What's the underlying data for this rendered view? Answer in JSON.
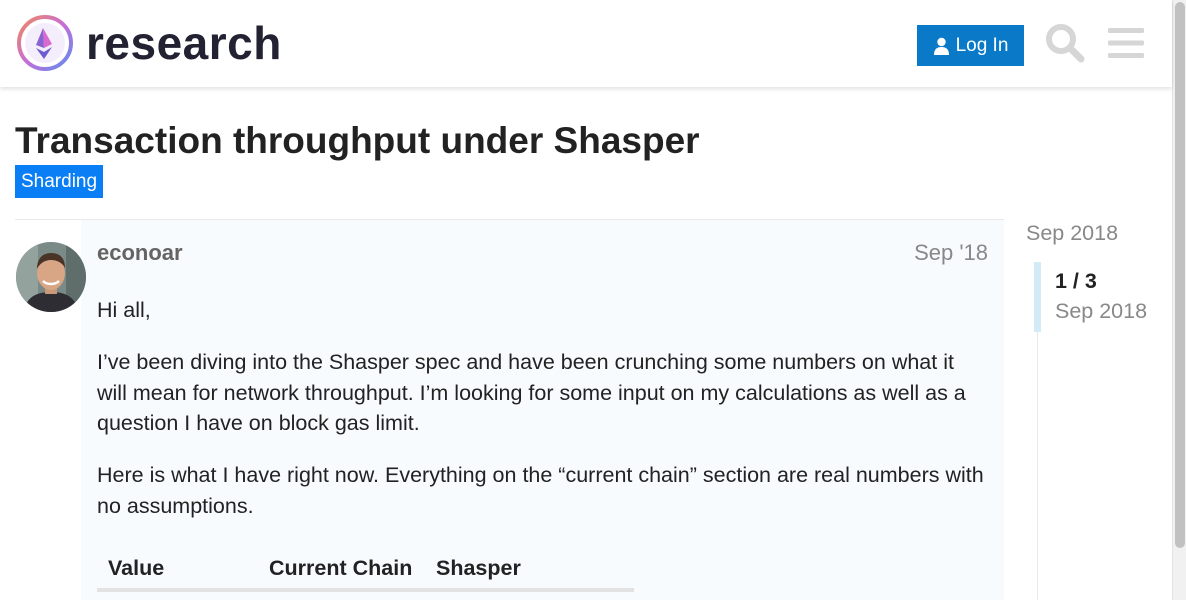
{
  "header": {
    "site_name": "research",
    "login_label": "Log In",
    "colors": {
      "accent": "#0a7ac8",
      "icon_gray": "#d6d6d6"
    }
  },
  "topic": {
    "title": "Transaction throughput under Shasper",
    "category": "Sharding",
    "category_color": "#0a7ef5"
  },
  "post": {
    "username": "econoar",
    "date": "Sep '18",
    "paragraphs": [
      "Hi all,",
      "I’ve been diving into the Shasper spec and have been crunching some numbers on what it will mean for network throughput. I’m looking for some input on my calculations as well as a question I have on block gas limit.",
      "Here is what I have right now. Everything on the “current chain” section are real numbers with no assumptions."
    ],
    "table": {
      "headers": [
        "Value",
        "Current Chain",
        "Shasper"
      ]
    }
  },
  "timeline": {
    "start_date": "Sep 2018",
    "position": "1 / 3",
    "current_date": "Sep 2018"
  }
}
